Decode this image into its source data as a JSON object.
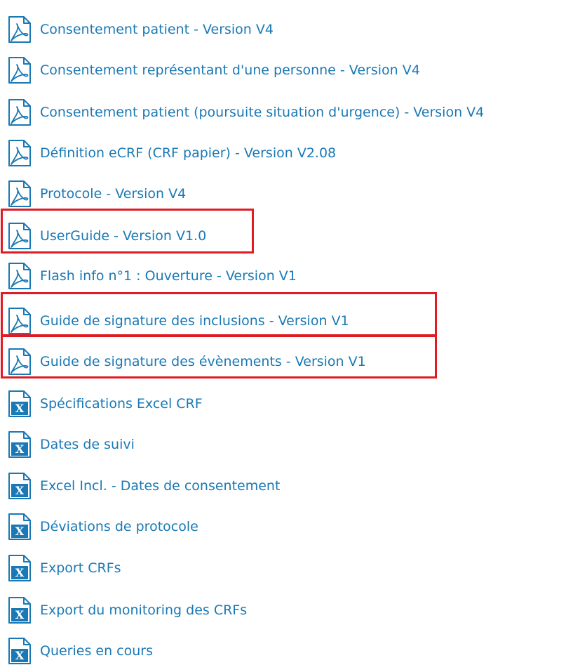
{
  "documents": [
    {
      "label": "Consentement patient - Version V4",
      "type": "pdf",
      "icon": "pdf-file-icon",
      "highlighted": false
    },
    {
      "label": "Consentement représentant d'une personne - Version V4",
      "type": "pdf",
      "icon": "pdf-file-icon",
      "highlighted": false
    },
    {
      "label": "Consentement patient (poursuite situation d'urgence) - Version V4",
      "type": "pdf",
      "icon": "pdf-file-icon",
      "highlighted": false
    },
    {
      "label": "Définition eCRF (CRF papier) - Version V2.08",
      "type": "pdf",
      "icon": "pdf-file-icon",
      "highlighted": false
    },
    {
      "label": "Protocole - Version V4",
      "type": "pdf",
      "icon": "pdf-file-icon",
      "highlighted": false
    },
    {
      "label": "UserGuide - Version V1.0",
      "type": "pdf",
      "icon": "pdf-file-icon",
      "highlighted": true
    },
    {
      "label": "Flash info n°1 : Ouverture - Version V1",
      "type": "pdf",
      "icon": "pdf-file-icon",
      "highlighted": false
    },
    {
      "label": "Guide de signature des inclusions - Version V1",
      "type": "pdf",
      "icon": "pdf-file-icon",
      "highlighted": true
    },
    {
      "label": "Guide de signature des évènements - Version V1",
      "type": "pdf",
      "icon": "pdf-file-icon",
      "highlighted": true
    },
    {
      "label": "Spécifications Excel CRF",
      "type": "excel",
      "icon": "excel-file-icon",
      "highlighted": false
    },
    {
      "label": "Dates de suivi",
      "type": "excel",
      "icon": "excel-file-icon",
      "highlighted": false
    },
    {
      "label": "Excel Incl. - Dates de consentement",
      "type": "excel",
      "icon": "excel-file-icon",
      "highlighted": false
    },
    {
      "label": "Déviations de protocole",
      "type": "excel",
      "icon": "excel-file-icon",
      "highlighted": false
    },
    {
      "label": "Export CRFs",
      "type": "excel",
      "icon": "excel-file-icon",
      "highlighted": false
    },
    {
      "label": "Export du monitoring des CRFs",
      "type": "excel",
      "icon": "excel-file-icon",
      "highlighted": false
    },
    {
      "label": "Queries en cours",
      "type": "excel",
      "icon": "excel-file-icon",
      "highlighted": false
    }
  ],
  "colors": {
    "link": "#1a79b5",
    "icon": "#1a79b5",
    "highlight": "#e11b24"
  }
}
